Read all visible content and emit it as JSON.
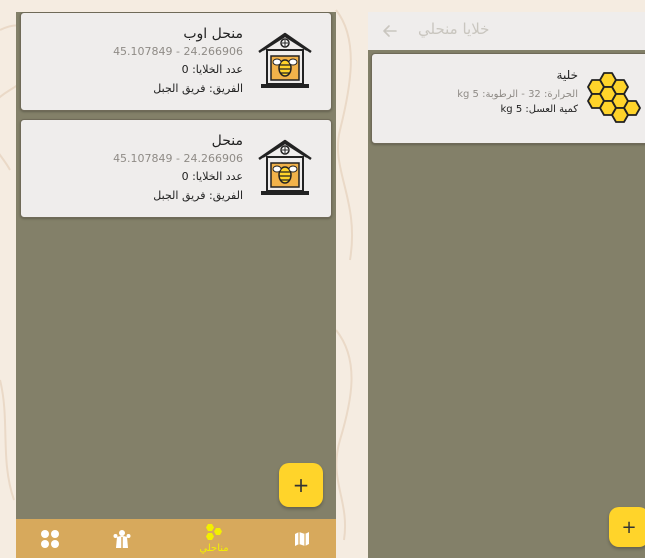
{
  "left_screen": {
    "apiaries": [
      {
        "name": "منحل اوب",
        "coords": "45.107849 - 24.266906",
        "hive_count": "عدد الخلايا: 0",
        "team": "الفريق: فريق الجبل"
      },
      {
        "name": "منحل",
        "coords": "45.107849 - 24.266906",
        "hive_count": "عدد الخلايا: 0",
        "team": "الفريق: فريق الجبل"
      }
    ],
    "add_button": "+",
    "bottom_nav": {
      "items": [
        {
          "icon": "grid-icon"
        },
        {
          "icon": "team-icon"
        },
        {
          "icon": "apiaries-icon",
          "label": "مناحلي",
          "active": true
        },
        {
          "icon": "map-icon"
        }
      ],
      "active_color": "#f3f000",
      "bar_color": "#d7a95c"
    }
  },
  "right_screen": {
    "title": "خلايا منحلي",
    "cells": [
      {
        "name": "خلية",
        "meta": "الحرارة: 32 - الرطوبة: 5 kg",
        "honey": "كمية العسل: 5 kg"
      }
    ],
    "add_button": "+"
  },
  "colors": {
    "screen_bg": "#838069",
    "card_bg": "#efedec",
    "accent_yellow": "#ffd42a",
    "page_bg": "#f5ece1"
  }
}
